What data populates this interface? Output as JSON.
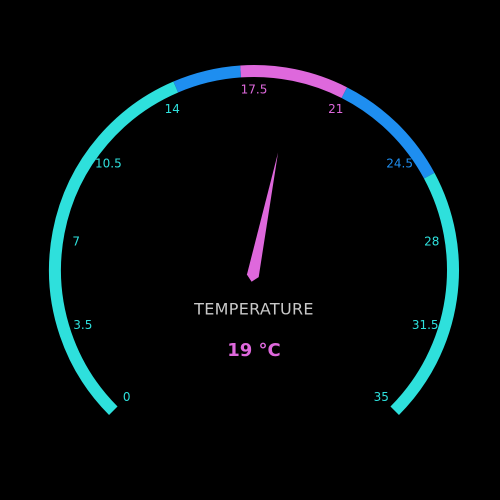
{
  "gauge": {
    "title": "TEMPERATURE",
    "value": 19,
    "value_text": "19 °C",
    "min": 0,
    "max": 35,
    "ticks": [
      "0",
      "3.5",
      "7",
      "10.5",
      "14",
      "17.5",
      "21",
      "24.5",
      "28",
      "31.5",
      "35"
    ],
    "bands": [
      {
        "from": 0,
        "to": 14.5,
        "color": "#2ee0dc"
      },
      {
        "from": 14.5,
        "to": 17,
        "color": "#1e8ef0"
      },
      {
        "from": 17,
        "to": 21,
        "color": "#de68dc"
      },
      {
        "from": 21,
        "to": 25.5,
        "color": "#1e8ef0"
      },
      {
        "from": 25.5,
        "to": 35,
        "color": "#2ee0dc"
      }
    ],
    "colors": {
      "background": "#000000",
      "needle": "#de68dc",
      "value_text": "#de68dc",
      "title_text": "#c8c8c8"
    }
  }
}
